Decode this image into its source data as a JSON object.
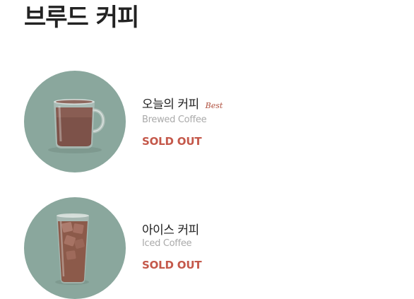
{
  "section": {
    "title": "브루드 커피"
  },
  "menu": {
    "items": [
      {
        "name_ko": "오늘의 커피",
        "badge": "Best",
        "name_en": "Brewed Coffee",
        "status": "SOLD OUT",
        "icon": "hot-coffee-mug-icon"
      },
      {
        "name_ko": "아이스 커피",
        "name_en": "Iced Coffee",
        "status": "SOLD OUT",
        "icon": "iced-coffee-cup-icon"
      }
    ]
  },
  "colors": {
    "thumb_background": "#8aa79d",
    "sold_out": "#c4584a",
    "badge": "#b0513f",
    "title": "#222222",
    "subtitle": "#aaaaaa"
  }
}
